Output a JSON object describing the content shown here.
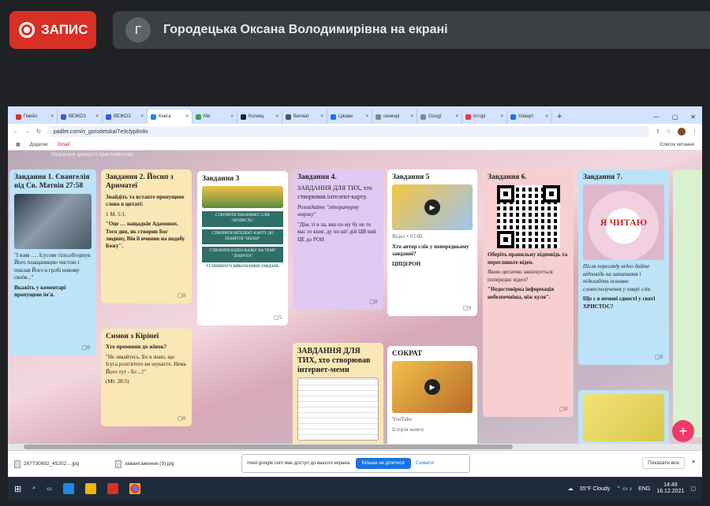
{
  "meet": {
    "record_label": "ЗАПИС",
    "presenter_initial": "Г",
    "presenter_text": "Городецька Оксана Володимирівна на екрані"
  },
  "browser": {
    "tabs": [
      {
        "label": "Гмейл",
        "color": "#d93025"
      },
      {
        "label": "ВЕЖОЗ",
        "color": "#3b5bdb"
      },
      {
        "label": "ВЕЖОЗ",
        "color": "#3b5bdb"
      },
      {
        "label": "Книга",
        "color": "#1e88e5",
        "active": true
      },
      {
        "label": "Ме",
        "color": "#34a853"
      },
      {
        "label": "Колекц",
        "color": "#222"
      },
      {
        "label": "Ватмат",
        "color": "#555"
      },
      {
        "label": "Цікаве",
        "color": "#1a73e8"
      },
      {
        "label": "синкорі",
        "color": "#888"
      },
      {
        "label": "Googl",
        "color": "#888"
      },
      {
        "label": "Історі",
        "color": "#e34"
      },
      {
        "label": "Ховарт",
        "color": "#1a73e8"
      }
    ],
    "url": "padlet.com/o_gorodetska/7e9clyp8n8x",
    "bookmarks": [
      "Додатки",
      "Gmail"
    ],
    "reading_list": "Список читання"
  },
  "padlet": {
    "watermark": "Моральні цінності християнства",
    "cards": {
      "c1": {
        "title": "Завдання 1. Євангелія від Св. Матвія 27:58",
        "text1": "\"І взяв …. Ісусове тіло,обгорнув Його плащаницею чистою і поклав Його в гробі новому своїм...\"",
        "text2": "Вкажіть у коментарі пропущене ім'я.",
        "count": "0"
      },
      "c2": {
        "title": "Завдання 2. Йосип з Ариматеї",
        "text1": "Знайдіть та вставте пропущене слово в цитаті:",
        "text2": "1 М. 5:1.",
        "text3": "\"Оце … нащадків Адамових. Того дня, як створив Бог людину, Він її вчинив на подобу Божу\".",
        "count": "0"
      },
      "c3": {
        "title": "Завдання 3",
        "b1": "СТВОРИТИ ХМАРИНКУ СЛІВ \"МУДРІСТЬ\"",
        "b2": "СТВОРИТИ ІНТЕЛЕКТ-КАРТУ ДО ПОНЯТТЯ \"БІБЛІЯ\"",
        "b3": "СТВОРИТИ ВІДЕО-КАЗКУ НА ТЕМУ \"ДОБРОТА\"",
        "footer": "УСПІШНОГО ВИКОНАННЯ ЗАВДАНЬ",
        "count": "5"
      },
      "c4": {
        "title": "Завдання 4.",
        "sub": "ЗАВДАННЯ ДЛЯ ТИХ, хто створював інтелект-карту.",
        "text1": "Розгадайте \"літературну морзку\"",
        "text2": "\"Дім, ті в ла, яко по му бу не то мас го книг, ду по ші! дій ЦИ вий ЦЕ до РОН",
        "count": "0"
      },
      "c5": {
        "title": "Завдання 5",
        "caption": "Відео • 03:06",
        "text1": "Хто автор слів у попередньому завданні?",
        "text2": "ЦИЦЕРОН",
        "count": "0"
      },
      "c6": {
        "title": "Завдання 6.",
        "text1": "Оберіть правильну відповідь та перегляньте відео.",
        "text2": "Якою цитатою закінчується попереднє відео?",
        "text3": "\"Недостовірна інформація небезпечніша, ніж куля\".",
        "count": "0"
      },
      "c7": {
        "title": "Завдання 7.",
        "img": "Я ЧИТАЮ",
        "text1": "Після перегляду відео дайте відповідь на запитання і підкладіть основне словосполучення у хмарі слів.",
        "text2": "Що є в немові єдності у святі ХРИСТОС?",
        "count": "0"
      },
      "c8": {
        "title": "Симон з Кірінеї",
        "text1": "Хто промовив до жінок?",
        "text2": "\"Не лякайтесь. Бо я знаю, що Ісуса розп'ятого ви шукаєте. Нема Його тут - бо ...!\"",
        "text3": "(Мт. 28:5)",
        "count": "0"
      },
      "c9": {
        "title": "ЗАВДАННЯ ДЛЯ ТИХ, хто створював інтернет-меми"
      },
      "c10": {
        "title": "СОКРАТ",
        "caption": "YouTube",
        "sub": "Історія книги"
      }
    }
  },
  "downloads": {
    "files": [
      "267730892_45202....jpg",
      "завантаження (9).jpg"
    ],
    "banner_text": "meet.google.com має доступ до вашого екрана.",
    "stop_btn": "Більше не ділитися",
    "hide_btn": "Сховати",
    "show_all": "Показати все"
  },
  "taskbar": {
    "weather": "35°F Cloudy",
    "lang": "ENG",
    "time": "14:49",
    "date": "16.12.2021"
  }
}
